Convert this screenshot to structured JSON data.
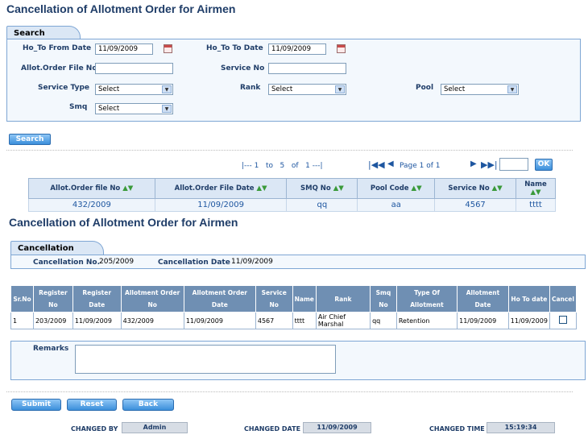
{
  "page_title": "Cancellation of Allotment Order for Airmen",
  "search": {
    "tab_label": "Search",
    "from_date_label": "Ho_To From Date",
    "from_date_value": "11/09/2009",
    "to_date_label": "Ho_To To Date",
    "to_date_value": "11/09/2009",
    "file_no_label": "Allot.Order File No",
    "service_no_label": "Service No",
    "service_type_label": "Service Type",
    "service_type_value": "Select",
    "rank_label": "Rank",
    "rank_value": "Select",
    "pool_label": "Pool",
    "pool_value": "Select",
    "smq_label": "Smq",
    "smq_value": "Select",
    "search_button": "Search"
  },
  "pagination": {
    "range_text": "|--- 1   to   5   of   1 ---|",
    "page_text": "Page 1 of 1",
    "ok_button": "OK"
  },
  "results": {
    "columns": [
      "Allot.Order file No",
      "Allot.Order File Date",
      "SMQ No",
      "Pool Code",
      "Service No",
      "Name"
    ],
    "rows": [
      [
        "432/2009",
        "11/09/2009",
        "qq",
        "aa",
        "4567",
        "tttt"
      ]
    ]
  },
  "section_title": "Cancellation of Allotment Order for Airmen",
  "cancellation": {
    "tab_label": "Cancellation",
    "no_label": "Cancellation No.",
    "no_value": "205/2009",
    "date_label": "Cancellation Date",
    "date_value": "11/09/2009"
  },
  "detail": {
    "columns": [
      "Sr.No",
      "Register No",
      "Register Date",
      "Allotment Order No",
      "Allotment Order Date",
      "Service No",
      "Name",
      "Rank",
      "Smq No",
      "Type Of Allotment",
      "Allotment Date",
      "Ho To date",
      "Cancel"
    ],
    "rows": [
      [
        "1",
        "203/2009",
        "11/09/2009",
        "432/2009",
        "11/09/2009",
        "4567",
        "tttt",
        "Air Chief Marshal",
        "qq",
        "Retention",
        "11/09/2009",
        "11/09/2009"
      ]
    ]
  },
  "remarks_label": "Remarks",
  "buttons": {
    "submit": "Submit",
    "reset": "Reset",
    "back": "Back"
  },
  "footer": {
    "changed_by_label": "CHANGED BY",
    "changed_by_value": "Admin",
    "changed_date_label": "CHANGED DATE",
    "changed_date_value": "11/09/2009",
    "changed_time_label": "CHANGED TIME",
    "changed_time_value": "15:19:34"
  },
  "colors": {
    "title": "#1f3d68",
    "link": "#1e56a0",
    "panel_border": "#7ea6d4",
    "button": "#3b8fdb"
  }
}
